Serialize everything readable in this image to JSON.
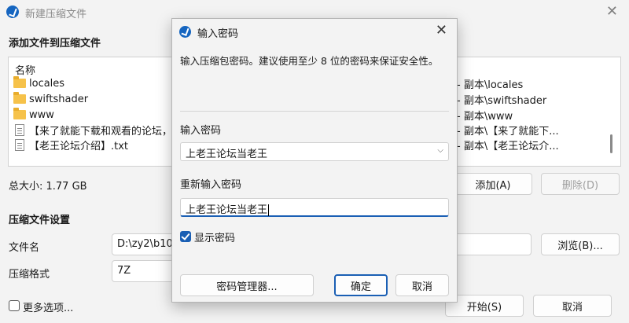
{
  "window": {
    "title": "新建压缩文件",
    "add_section_title": "添加文件到压缩文件",
    "column_header": "名称",
    "files": [
      {
        "name": "locales",
        "icon": "folder-icon",
        "path": "- 副本\\locales"
      },
      {
        "name": "swiftshader",
        "icon": "folder-icon",
        "path": "- 副本\\swiftshader"
      },
      {
        "name": "www",
        "icon": "folder-icon",
        "path": "- 副本\\www"
      },
      {
        "name": "【来了就能下载和观看的论坛，纯",
        "icon": "text-file-icon",
        "path": "- 副本\\【来了就能下..."
      },
      {
        "name": "【老王论坛介绍】.txt",
        "icon": "text-file-icon",
        "path": "- 副本\\【老王论坛介..."
      }
    ],
    "total_size": "总大小: 1.77 GB",
    "add_button": "添加(A)",
    "delete_button": "删除(D)",
    "settings_title": "压缩文件设置",
    "filename_label": "文件名",
    "filename_value": "D:\\zy2\\b10r",
    "browse_button": "浏览(B)...",
    "format_label": "压缩格式",
    "format_value": "7Z",
    "more_options_label": "更多选项...",
    "start_button": "开始(S)",
    "cancel_button": "取消"
  },
  "dialog": {
    "title": "输入密码",
    "description": "输入压缩包密码。建议使用至少 8 位的密码来保证安全性。",
    "password_label": "输入密码",
    "password_value": "上老王论坛当老王",
    "reenter_label": "重新输入密码",
    "reenter_value": "上老王论坛当老王",
    "show_password_label": "显示密码",
    "show_password_checked": true,
    "manager_button": "密码管理器...",
    "ok_button": "确定",
    "cancel_button": "取消"
  },
  "colors": {
    "accent": "#1a5fb4",
    "folder": "#f6c24a"
  }
}
